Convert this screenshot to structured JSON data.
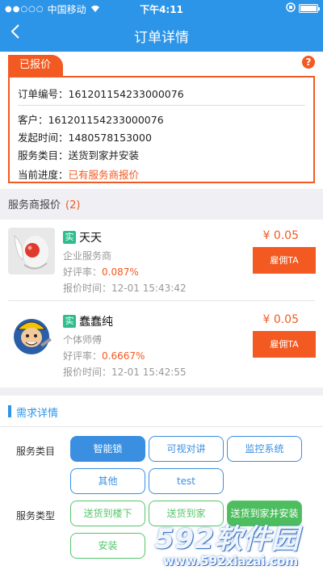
{
  "status_bar": {
    "carrier": "中国移动",
    "time": "下午4:11"
  },
  "nav": {
    "title": "订单详情",
    "back_icon": "chevron-left-icon"
  },
  "order": {
    "status_tab": "已报价",
    "help_icon_label": "?",
    "order_no_label": "订单编号：",
    "order_no": "161201154233000076",
    "customer_label": "客户：",
    "customer": "161201154233000076",
    "start_time_label": "发起时间：",
    "start_time": "1480578153000",
    "service_label": "服务类目：",
    "service": "送货到家并安装",
    "progress_label": "当前进度：",
    "progress": "已有服务商报价"
  },
  "quotes": {
    "header": "服务商报价",
    "count": "(2)",
    "providers": [
      {
        "badge": "实",
        "name": "天天",
        "type": "企业服务商",
        "rate_label": "好评率：",
        "rate": "0.087%",
        "time_label": "报价时间：",
        "time": "12-01 15:43:42",
        "price": "¥ 0.05",
        "hire_label": "雇佣TA"
      },
      {
        "badge": "实",
        "name": "蠢蠢纯",
        "type": "个体师傅",
        "rate_label": "好评率：",
        "rate": "0.6667%",
        "time_label": "报价时间：",
        "time": "12-01 15:42:55",
        "price": "¥ 0.05",
        "hire_label": "雇佣TA"
      }
    ]
  },
  "requirements": {
    "title": "需求详情",
    "category_label": "服务类目",
    "categories": [
      "智能锁",
      "可视对讲",
      "监控系统",
      "其他",
      "test"
    ],
    "type_label": "服务类型",
    "types": [
      "送货到楼下",
      "送货到家",
      "送货到家并安装",
      "安装"
    ]
  },
  "watermark": {
    "brand": "592软件园",
    "url": "www.592xiazai.com"
  },
  "colors": {
    "primary_blue": "#2d95e8",
    "accent_orange": "#f25a21",
    "green": "#4dbd5f"
  }
}
